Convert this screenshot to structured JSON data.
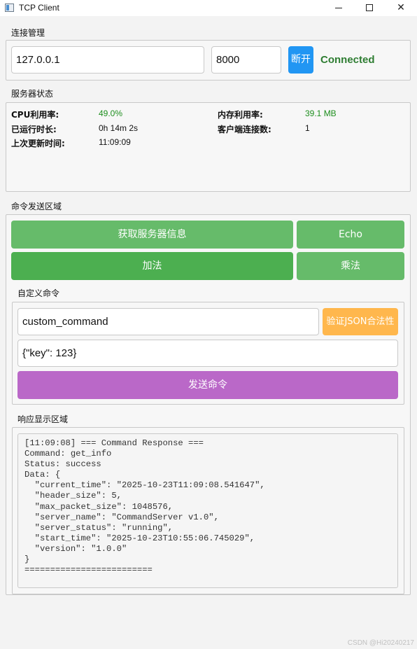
{
  "window": {
    "title": "TCP Client",
    "min_symbol": "—",
    "max_symbol": "□",
    "close_symbol": "✕"
  },
  "connection": {
    "group_title": "连接管理",
    "host": "127.0.0.1",
    "port": "8000",
    "disconnect_label": "断开",
    "status": "Connected"
  },
  "server_status": {
    "group_title": "服务器状态",
    "cpu_label": "CPU利用率:",
    "cpu_value": "49.0%",
    "mem_label": "内存利用率:",
    "mem_value": "39.1 MB",
    "uptime_label": "已运行时长:",
    "uptime_value": "0h 14m 2s",
    "clients_label": "客户端连接数:",
    "clients_value": "1",
    "updated_label": "上次更新时间:",
    "updated_value": "11:09:09"
  },
  "commands": {
    "group_title": "命令发送区域",
    "get_info_label": "获取服务器信息",
    "echo_label": "Echo",
    "add_label": "加法",
    "multiply_label": "乘法"
  },
  "custom": {
    "group_title": "自定义命令",
    "command_value": "custom_command",
    "validate_label": "验证JSON合法性",
    "params_value": "{\"key\": 123}",
    "send_label": "发送命令"
  },
  "response": {
    "group_title": "响应显示区域",
    "text": "[11:09:08] === Command Response ===\nCommand: get_info\nStatus: success\nData: {\n  \"current_time\": \"2025-10-23T11:09:08.541647\",\n  \"header_size\": 5,\n  \"max_packet_size\": 1048576,\n  \"server_name\": \"CommandServer v1.0\",\n  \"server_status\": \"running\",\n  \"start_time\": \"2025-10-23T10:55:06.745029\",\n  \"version\": \"1.0.0\"\n}\n========================="
  },
  "watermark": "CSDN @Hi20240217",
  "colors": {
    "blue_button": "#2196f3",
    "green_button": "#66bb6a",
    "green_button_active": "#4caf50",
    "orange_button": "#ffb74d",
    "purple_button": "#ba68c8",
    "status_green": "#2e7d32"
  }
}
